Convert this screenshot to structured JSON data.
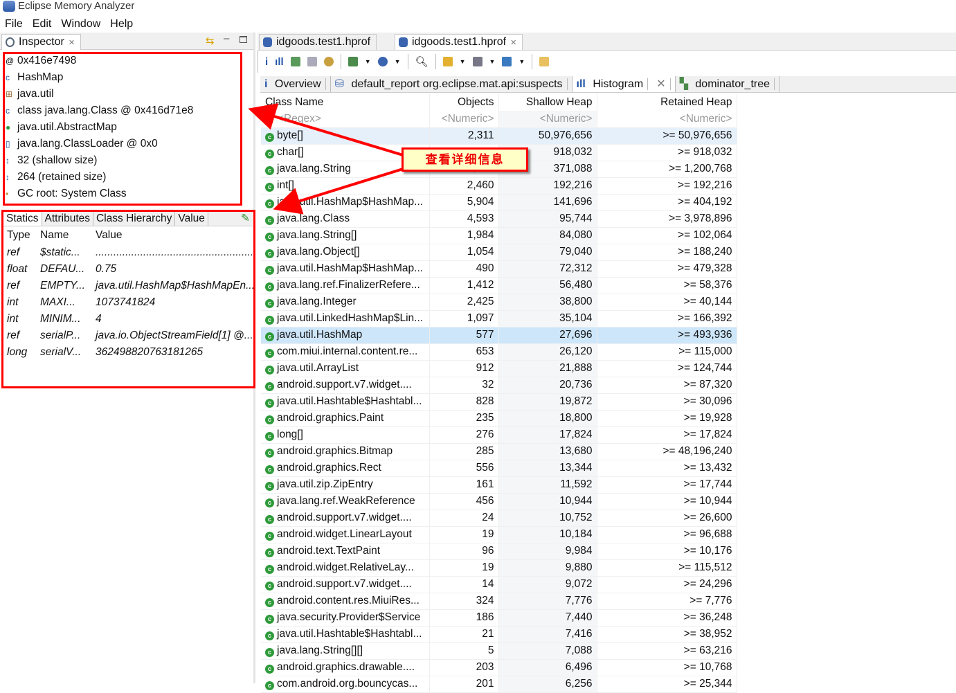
{
  "app": {
    "title": "Eclipse Memory Analyzer"
  },
  "menu": [
    "File",
    "Edit",
    "Window",
    "Help"
  ],
  "inspector": {
    "tab": "Inspector",
    "items": [
      {
        "icon": "at-icon",
        "text": "0x416e7498"
      },
      {
        "icon": "class-icon",
        "text": "HashMap"
      },
      {
        "icon": "package-icon",
        "text": "java.util"
      },
      {
        "icon": "class-icon",
        "text": "class java.lang.Class @ 0x416d71e8"
      },
      {
        "icon": "superclass-icon",
        "text": "java.util.AbstractMap"
      },
      {
        "icon": "classloader-icon",
        "text": "java.lang.ClassLoader @ 0x0"
      },
      {
        "icon": "size-icon",
        "text": "32 (shallow size)"
      },
      {
        "icon": "size-icon",
        "text": "264 (retained size)"
      },
      {
        "icon": "gc-root-icon",
        "text": "GC root: System Class"
      }
    ],
    "subtabs": [
      "Statics",
      "Attributes",
      "Class Hierarchy",
      "Value"
    ],
    "columns": [
      "Type",
      "Name",
      "Value"
    ],
    "rows": [
      [
        "ref",
        "$static...",
        "..........................................................."
      ],
      [
        "float",
        "DEFAU...",
        "0.75"
      ],
      [
        "ref",
        "EMPTY...",
        "java.util.HashMap$HashMapEn..."
      ],
      [
        "int",
        "MAXI...",
        "1073741824"
      ],
      [
        "int",
        "MINIM...",
        "4"
      ],
      [
        "ref",
        "serialP...",
        "java.io.ObjectStreamField[1] @..."
      ],
      [
        "long",
        "serialV...",
        "362498820763181265"
      ]
    ]
  },
  "editor": {
    "tabs": [
      "idgoods.test1.hprof",
      "idgoods.test1.hprof"
    ],
    "views": [
      "Overview",
      "default_report  org.eclipse.mat.api:suspects",
      "Histogram",
      "dominator_tree"
    ],
    "columns": [
      "Class Name",
      "Objects",
      "Shallow Heap",
      "Retained Heap"
    ],
    "filters": [
      "<Regex>",
      "<Numeric>",
      "<Numeric>",
      "<Numeric>"
    ],
    "selected_row": "java.util.HashMap",
    "rows": [
      [
        "byte[]",
        "2,311",
        "50,976,656",
        ">= 50,976,656"
      ],
      [
        "char[]",
        "",
        "918,032",
        ">= 918,032"
      ],
      [
        "java.lang.String",
        "15,102",
        "371,088",
        ">= 1,200,768"
      ],
      [
        "int[]",
        "2,460",
        "192,216",
        ">= 192,216"
      ],
      [
        "java.util.HashMap$HashMap...",
        "5,904",
        "141,696",
        ">= 404,192"
      ],
      [
        "java.lang.Class",
        "4,593",
        "95,744",
        ">= 3,978,896"
      ],
      [
        "java.lang.String[]",
        "1,984",
        "84,080",
        ">= 102,064"
      ],
      [
        "java.lang.Object[]",
        "1,054",
        "79,040",
        ">= 188,240"
      ],
      [
        "java.util.HashMap$HashMap...",
        "490",
        "72,312",
        ">= 479,328"
      ],
      [
        "java.lang.ref.FinalizerRefere...",
        "1,412",
        "56,480",
        ">= 58,376"
      ],
      [
        "java.lang.Integer",
        "2,425",
        "38,800",
        ">= 40,144"
      ],
      [
        "java.util.LinkedHashMap$Lin...",
        "1,097",
        "35,104",
        ">= 166,392"
      ],
      [
        "java.util.HashMap",
        "577",
        "27,696",
        ">= 493,936"
      ],
      [
        "com.miui.internal.content.re...",
        "653",
        "26,120",
        ">= 115,000"
      ],
      [
        "java.util.ArrayList",
        "912",
        "21,888",
        ">= 124,744"
      ],
      [
        "android.support.v7.widget....",
        "32",
        "20,736",
        ">= 87,320"
      ],
      [
        "java.util.Hashtable$Hashtabl...",
        "828",
        "19,872",
        ">= 30,096"
      ],
      [
        "android.graphics.Paint",
        "235",
        "18,800",
        ">= 19,928"
      ],
      [
        "long[]",
        "276",
        "17,824",
        ">= 17,824"
      ],
      [
        "android.graphics.Bitmap",
        "285",
        "13,680",
        ">= 48,196,240"
      ],
      [
        "android.graphics.Rect",
        "556",
        "13,344",
        ">= 13,432"
      ],
      [
        "java.util.zip.ZipEntry",
        "161",
        "11,592",
        ">= 17,744"
      ],
      [
        "java.lang.ref.WeakReference",
        "456",
        "10,944",
        ">= 10,944"
      ],
      [
        "android.support.v7.widget....",
        "24",
        "10,752",
        ">= 26,600"
      ],
      [
        "android.widget.LinearLayout",
        "19",
        "10,184",
        ">= 96,688"
      ],
      [
        "android.text.TextPaint",
        "96",
        "9,984",
        ">= 10,176"
      ],
      [
        "android.widget.RelativeLay...",
        "19",
        "9,880",
        ">= 115,512"
      ],
      [
        "android.support.v7.widget....",
        "14",
        "9,072",
        ">= 24,296"
      ],
      [
        "android.content.res.MiuiRes...",
        "324",
        "7,776",
        ">= 7,776"
      ],
      [
        "java.security.Provider$Service",
        "186",
        "7,440",
        ">= 36,248"
      ],
      [
        "java.util.Hashtable$Hashtabl...",
        "21",
        "7,416",
        ">= 38,952"
      ],
      [
        "java.lang.String[][]",
        "5",
        "7,088",
        ">= 63,216"
      ],
      [
        "android.graphics.drawable....",
        "203",
        "6,496",
        ">= 10,768"
      ],
      [
        "com.android.org.bouncycas...",
        "201",
        "6,256",
        ">= 25,344"
      ]
    ]
  },
  "annotation": {
    "callout": "查看详细信息",
    "color": "#ff0000"
  }
}
